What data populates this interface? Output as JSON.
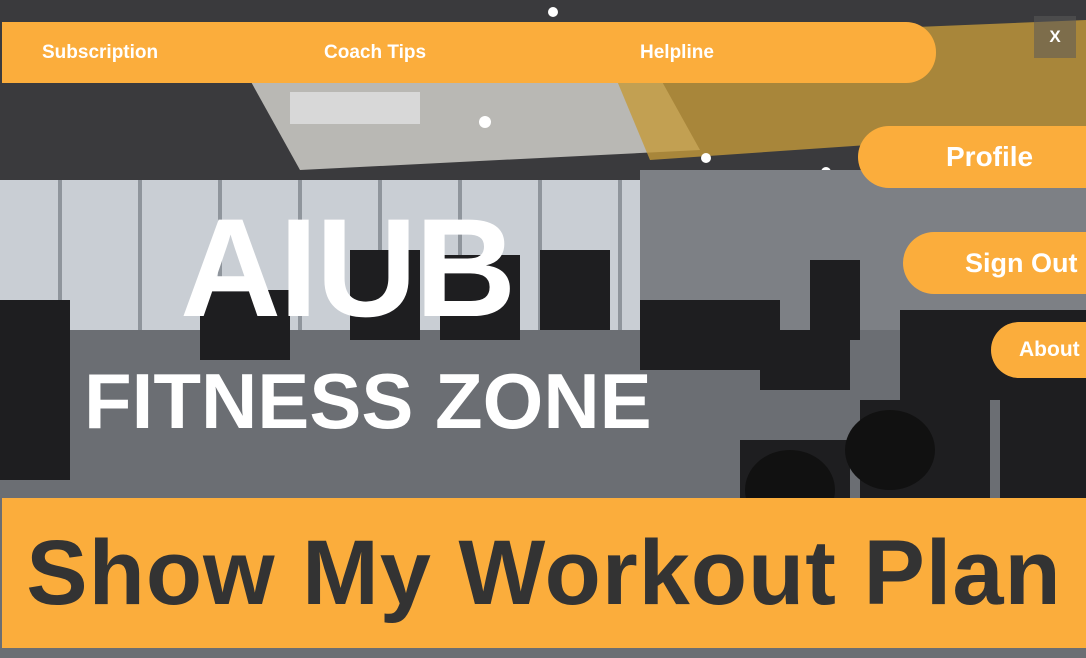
{
  "window": {
    "close_label": "X"
  },
  "topnav": {
    "items": [
      {
        "label": "Subscription"
      },
      {
        "label": "Coach Tips"
      },
      {
        "label": "Helpline"
      }
    ]
  },
  "side_menu": {
    "profile": "Profile",
    "sign_out": "Sign Out",
    "about": "About"
  },
  "hero": {
    "title_line1": "AIUB",
    "title_line2": "FITNESS ZONE"
  },
  "action": {
    "label": "Show My Workout Plan"
  },
  "colors": {
    "accent": "#fbad3c",
    "cta_text": "#333333",
    "text_light": "#ffffff"
  }
}
